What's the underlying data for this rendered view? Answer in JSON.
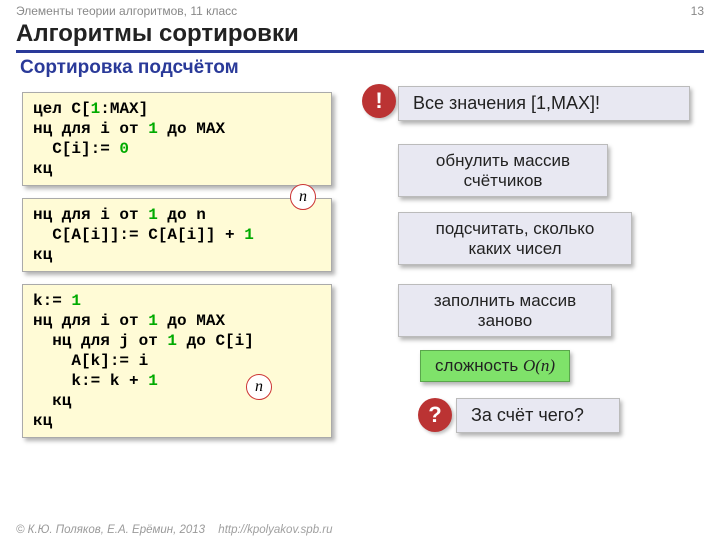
{
  "header": {
    "course": "Элементы теории алгоритмов, 11 класс",
    "page_num": "13",
    "title": "Алгоритмы сортировки",
    "subtitle": "Сортировка подсчётом"
  },
  "badges": {
    "exclaim": "!",
    "question": "?",
    "n1": "n",
    "n2": "n"
  },
  "notes": {
    "range": "Все значения [1,MAX]!",
    "zero": "обнулить массив счётчиков",
    "count": "подсчитать, сколько каких чисел",
    "fill": "заполнить массив заново",
    "complexity_label": "сложность ",
    "complexity_o": "O",
    "complexity_n": "(n)",
    "why": "За счёт чего?"
  },
  "code1": {
    "l1a": "цел",
    "l1b": " C[",
    "l1c": "1",
    "l1d": ":MAX]",
    "l2a": "нц для i от ",
    "l2b": "1",
    "l2c": " до MAX",
    "l3a": "  C[i]:= ",
    "l3b": "0",
    "l4": "кц"
  },
  "code2": {
    "l1a": "нц для i от ",
    "l1b": "1",
    "l1c": " до n",
    "l2a": "  C[A[i]]:= C[A[i]] + ",
    "l2b": "1",
    "l3": "кц"
  },
  "code3": {
    "l1a": "k:= ",
    "l1b": "1",
    "l2a": "нц для i от ",
    "l2b": "1",
    "l2c": " до MAX",
    "l3a": "  нц для j от ",
    "l3b": "1",
    "l3c": " до C[i]",
    "l4": "    A[k]:= i",
    "l5a": "    k:= k + ",
    "l5b": "1",
    "l6": "  кц",
    "l7": "кц"
  },
  "footer": {
    "copyright": "© К.Ю. Поляков, Е.А. Ерёмин, 2013",
    "url": "http://kpolyakov.spb.ru"
  }
}
